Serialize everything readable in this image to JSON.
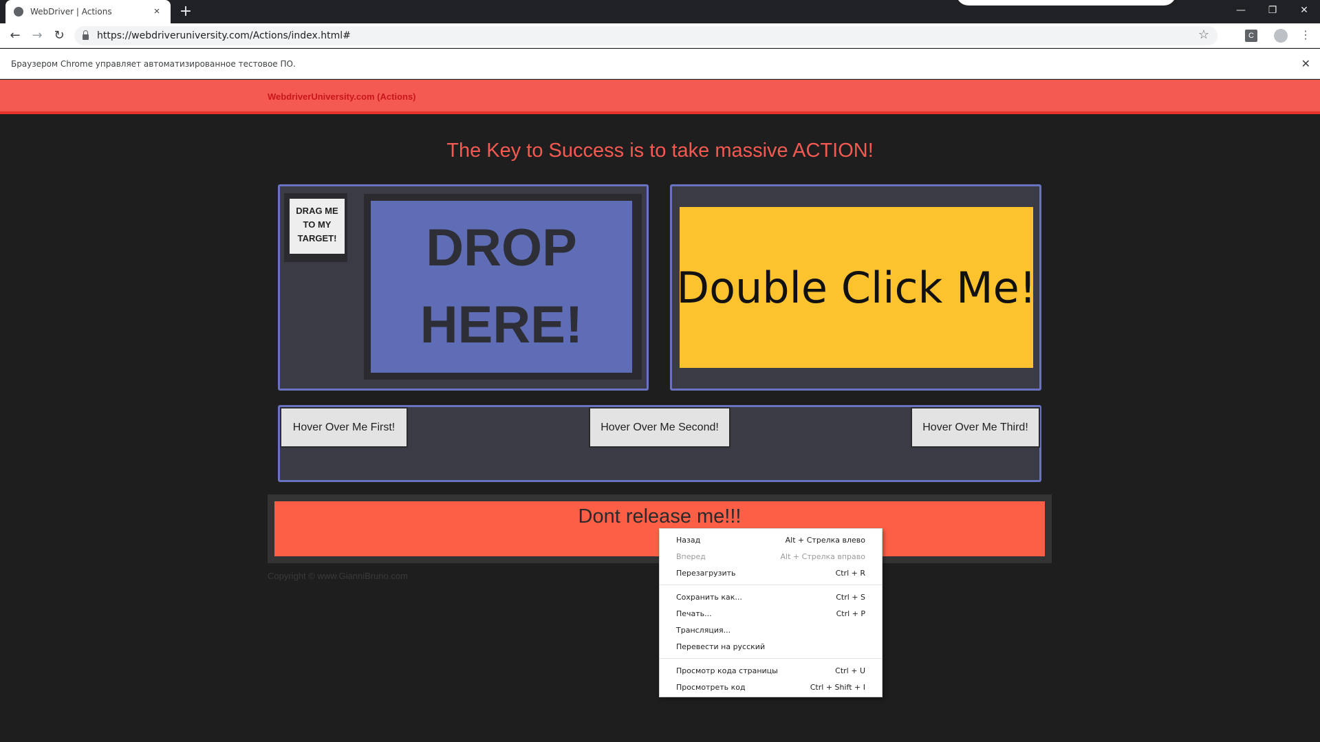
{
  "browser": {
    "tab_title": "WebDriver | Actions",
    "tab_close": "×",
    "new_tab": "+",
    "url": "https://webdriveruniversity.com/Actions/index.html#",
    "nav": {
      "back": "←",
      "forward": "→",
      "reload": "↻"
    },
    "star": "☆",
    "extension_letter": "C",
    "menu": "⋮",
    "window_controls": {
      "minimize": "—",
      "restore": "❐",
      "close": "✕"
    },
    "infobar_text": "Браузером Chrome управляет автоматизированное тестовое ПО.",
    "infobar_close": "✕"
  },
  "page": {
    "brand": "WebdriverUniversity.com (Actions)",
    "headline": "The Key to Success is to take massive ACTION!",
    "draggable_text": "DRAG ME TO MY TARGET!",
    "droppable_text": "DROP HERE!",
    "double_click_text": "Double Click Me!",
    "hover_buttons": [
      "Hover Over Me First!",
      "Hover Over Me Second!",
      "Hover Over Me Third!"
    ],
    "release_text": "Dont release me!!!",
    "copyright": "Copyright © www.GianniBruno.com"
  },
  "context_menu": [
    {
      "label": "Назад",
      "shortcut": "Alt + Стрелка влево",
      "enabled": true
    },
    {
      "label": "Вперед",
      "shortcut": "Alt + Стрелка вправо",
      "enabled": false
    },
    {
      "label": "Перезагрузить",
      "shortcut": "Ctrl + R",
      "enabled": true
    },
    {
      "label": "Сохранить как...",
      "shortcut": "Ctrl + S",
      "enabled": true
    },
    {
      "label": "Печать...",
      "shortcut": "Ctrl + P",
      "enabled": true
    },
    {
      "label": "Трансляция...",
      "shortcut": "",
      "enabled": true
    },
    {
      "label": "Перевести на русский",
      "shortcut": "",
      "enabled": true
    },
    {
      "label": "Просмотр кода страницы",
      "shortcut": "Ctrl + U",
      "enabled": true
    },
    {
      "label": "Просмотреть код",
      "shortcut": "Ctrl + Shift + I",
      "enabled": true
    }
  ],
  "colors": {
    "navbar": "#f45a52",
    "brand": "#c8161d",
    "panel_border": "#6a73c2",
    "droppable": "#5e6db5",
    "double_click": "#fcc32e",
    "release": "#fd5f46"
  }
}
